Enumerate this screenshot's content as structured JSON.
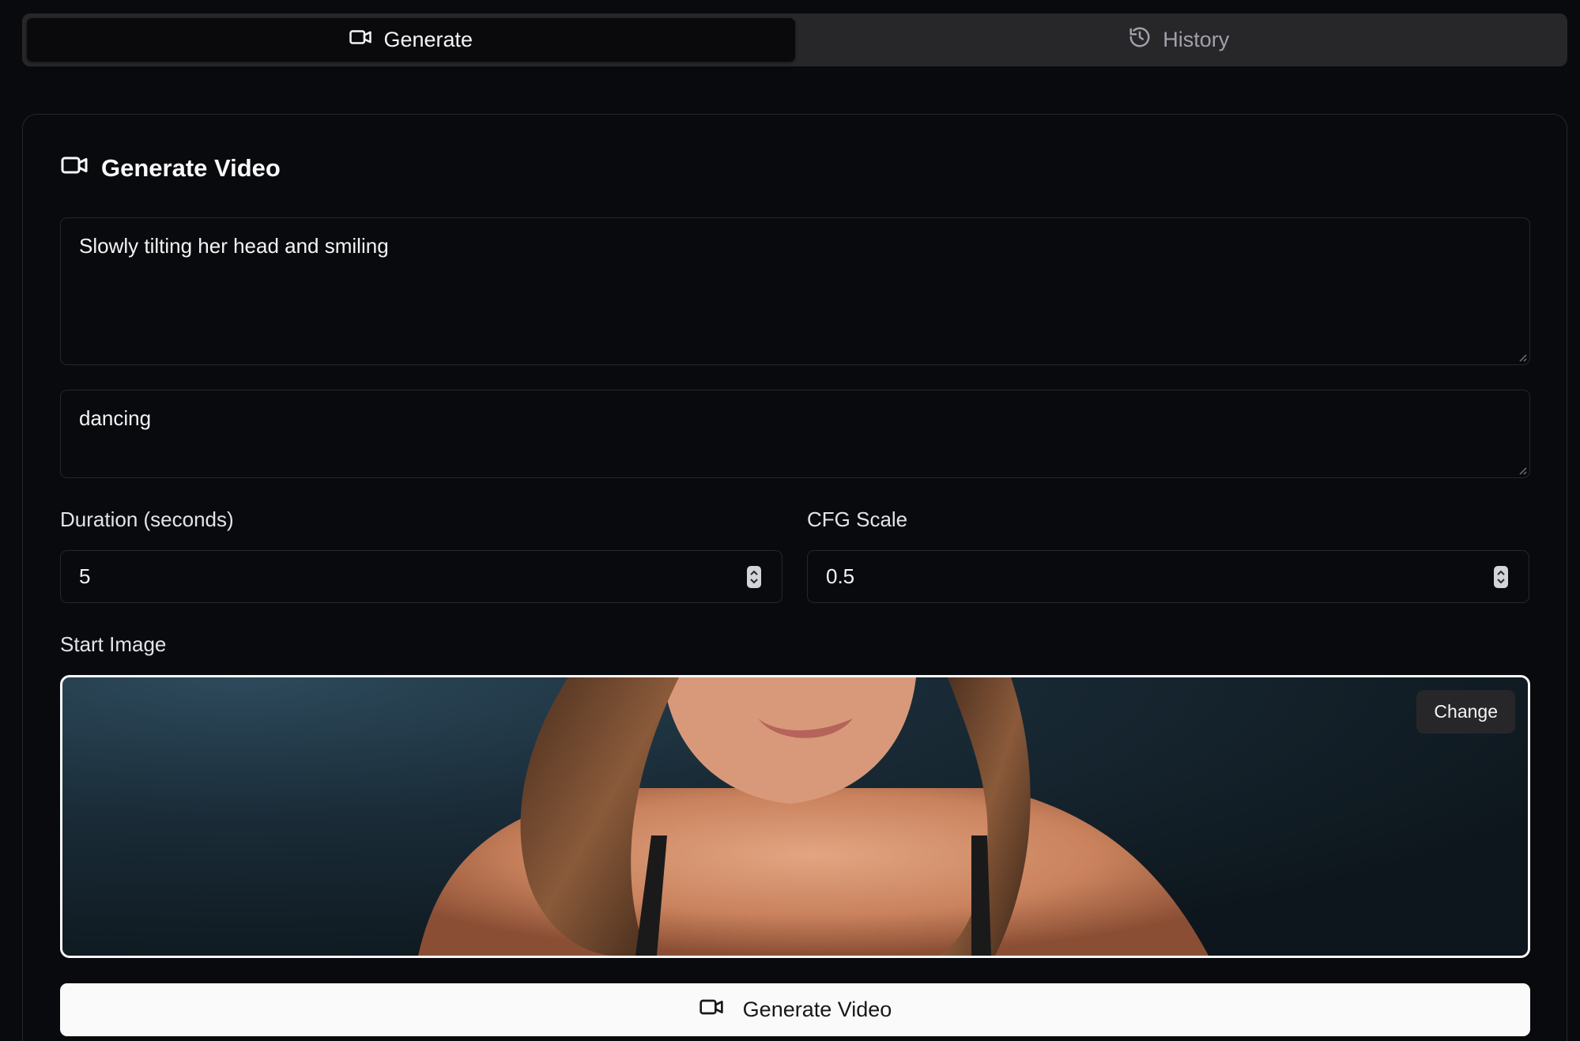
{
  "tabs": [
    {
      "label": "Generate",
      "icon": "video-camera-icon",
      "active": true
    },
    {
      "label": "History",
      "icon": "history-icon",
      "active": false
    }
  ],
  "card": {
    "title": "Generate Video",
    "prompt": "Slowly tilting her head and smiling",
    "negative_prompt": "dancing",
    "duration": {
      "label": "Duration (seconds)",
      "value": "5"
    },
    "cfg": {
      "label": "CFG Scale",
      "value": "0.5"
    },
    "start_image": {
      "label": "Start Image",
      "change_label": "Change"
    },
    "generate_label": "Generate Video"
  },
  "colors": {
    "background": "#090a0d",
    "tab_bar": "#27272a",
    "border": "#27272a",
    "button_primary": "#fafafa"
  }
}
